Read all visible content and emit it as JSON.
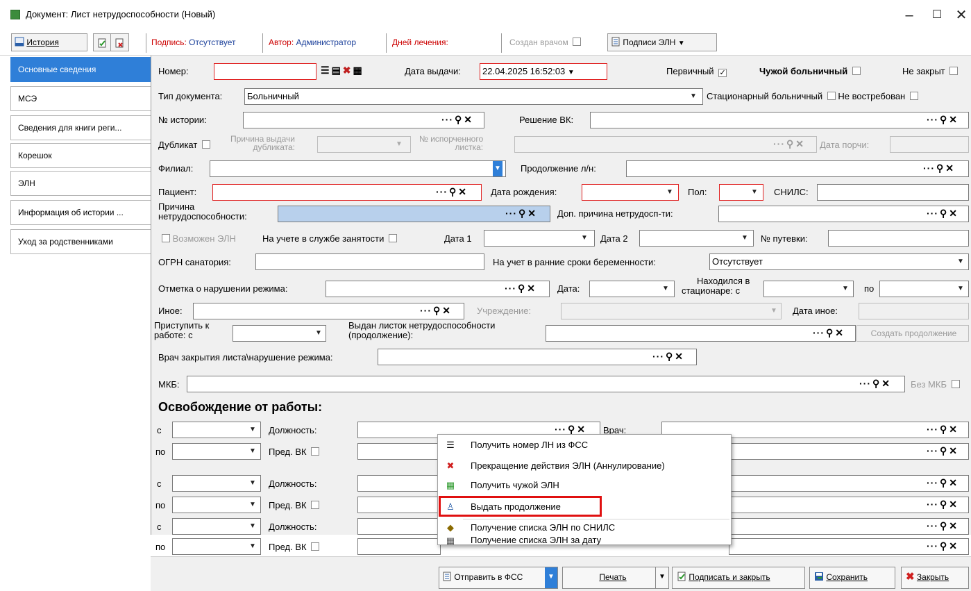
{
  "window": {
    "title": "Документ: Лист нетрудоспособности (Новый)"
  },
  "toolbar": {
    "history_label": "История",
    "signature_label": "Подпись:",
    "signature_value": "Отсутствует",
    "author_label": "Автор:",
    "author_value": "Администратор",
    "days_label": "Дней лечения:",
    "created_by_doctor": "Создан врачом",
    "eln_signatures": "Подписи ЭЛН"
  },
  "tabs": [
    "Основные сведения",
    "МСЭ",
    "Сведения для книги реги...",
    "Корешок",
    "ЭЛН",
    "Информация об истории ...",
    "Уход за родственниками"
  ],
  "form": {
    "number_label": "Номер:",
    "issue_date_label": "Дата выдачи:",
    "issue_date_value": "22.04.2025 16:52:03",
    "primary_label": "Первичный",
    "foreign_label": "Чужой больничный",
    "not_closed_label": "Не закрыт",
    "doc_type_label": "Тип документа:",
    "doc_type_value": "Больничный",
    "inpatient_label": "Стационарный больничный",
    "unclaimed_label": "Не востребован",
    "history_no_label": "№ истории:",
    "vk_decision_label": "Решение ВК:",
    "duplicate_label": "Дубликат",
    "dup_reason_l1": "Причина выдачи",
    "dup_reason_l2": "дубликата:",
    "spoiled_l1": "№ испорченного",
    "spoiled_l2": "листка:",
    "spoil_date_label": "Дата порчи:",
    "branch_label": "Филиал:",
    "continuation_label": "Продолжение л/н:",
    "patient_label": "Пациент:",
    "birth_label": "Дата рождения:",
    "sex_label": "Пол:",
    "snils_label": "СНИЛС:",
    "cause_l1": "Причина",
    "cause_l2": "нетрудоспособности:",
    "add_cause_label": "Доп. причина нетрудосп-ти:",
    "eln_possible_label": "Возможен ЭЛН",
    "employment_label": "На учете в службе занятости",
    "date1_label": "Дата 1",
    "date2_label": "Дата 2",
    "voucher_label": "№ путевки:",
    "ogrn_label": "ОГРН санатория:",
    "pregnancy_label": "На учет в ранние сроки беременности:",
    "pregnancy_value": "Отсутствует",
    "violation_label": "Отметка о нарушении режима:",
    "date_label": "Дата:",
    "hosp_l1": "Находился в",
    "hosp_l2": "стационаре: с",
    "to_label": "по",
    "other_label": "Иное:",
    "institution_label": "Учреждение:",
    "other_date_label": "Дата иное:",
    "start_l1": "Приступить к",
    "start_l2": "работе: с",
    "issued_l1": "Выдан листок нетрудоспособности",
    "issued_l2": "(продолжение):",
    "create_continuation": "Создать продолжение",
    "close_doctor_label": "Врач закрытия листа\\нарушение режима:",
    "mkb_label": "МКБ:",
    "no_mkb_label": "Без МКБ"
  },
  "release": {
    "heading": "Освобождение от работы:",
    "from_label": "с",
    "to_label": "по",
    "position_label": "Должность:",
    "doctor_label": "Врач:",
    "chair_vk_label": "Пред. ВК"
  },
  "context_menu": {
    "items": [
      {
        "label": "Получить номер ЛН из ФСС",
        "icon": "list-number-icon"
      },
      {
        "label": "Прекращение действия ЭЛН (Аннулирование)",
        "icon": "annul-doc-icon"
      },
      {
        "label": "Получить чужой ЭЛН",
        "icon": "doc-add-icon"
      },
      {
        "label": "Выдать продолжение",
        "icon": "continue-icon"
      },
      {
        "label": "Получение списка ЭЛН по СНИЛС",
        "icon": "tag-icon"
      },
      {
        "label": "Получение списка ЭЛН за дату",
        "icon": "calendar-icon"
      }
    ]
  },
  "footer": {
    "send_fss": "Отправить в ФСС",
    "print": "Печать",
    "sign_close": "Подписать и закрыть",
    "save": "Сохранить",
    "close": "Закрыть"
  },
  "colors": {
    "accent": "#2f7fd8",
    "error_border": "#e02020",
    "highlight": "#e01010",
    "danger_text": "#cc0000"
  }
}
